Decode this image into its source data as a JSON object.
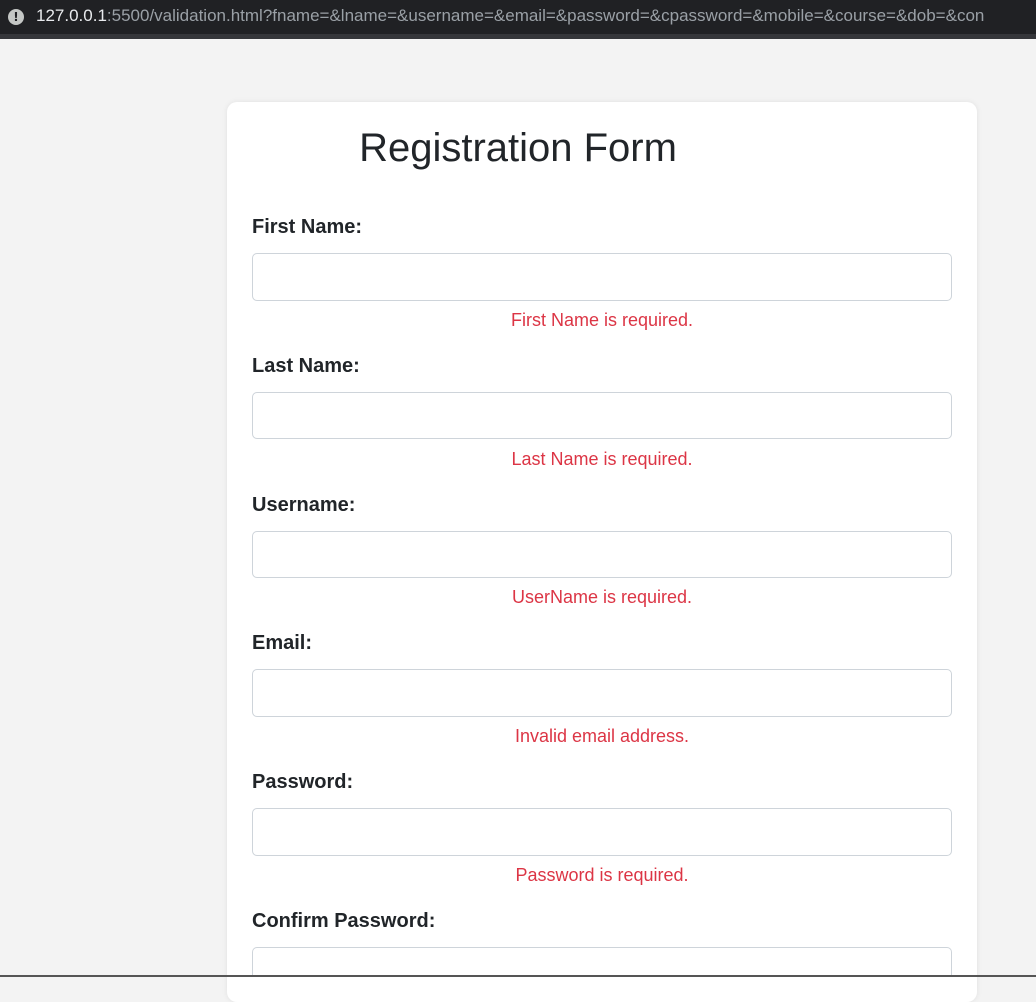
{
  "browser": {
    "url_host": "127.0.0.1",
    "url_rest": ":5500/validation.html?fname=&lname=&username=&email=&password=&cpassword=&mobile=&course=&dob=&con"
  },
  "form": {
    "title": "Registration Form",
    "fields": [
      {
        "label": "First Name:",
        "value": "",
        "error": "First Name is required."
      },
      {
        "label": "Last Name:",
        "value": "",
        "error": "Last Name is required."
      },
      {
        "label": "Username:",
        "value": "",
        "error": "UserName is required."
      },
      {
        "label": "Email:",
        "value": "",
        "error": "Invalid email address."
      },
      {
        "label": "Password:",
        "value": "",
        "error": "Password is required."
      },
      {
        "label": "Confirm Password:",
        "value": "",
        "error": ""
      }
    ]
  },
  "colors": {
    "error": "#dc3545",
    "page_background": "#f3f3f3",
    "card_background": "#ffffff"
  }
}
